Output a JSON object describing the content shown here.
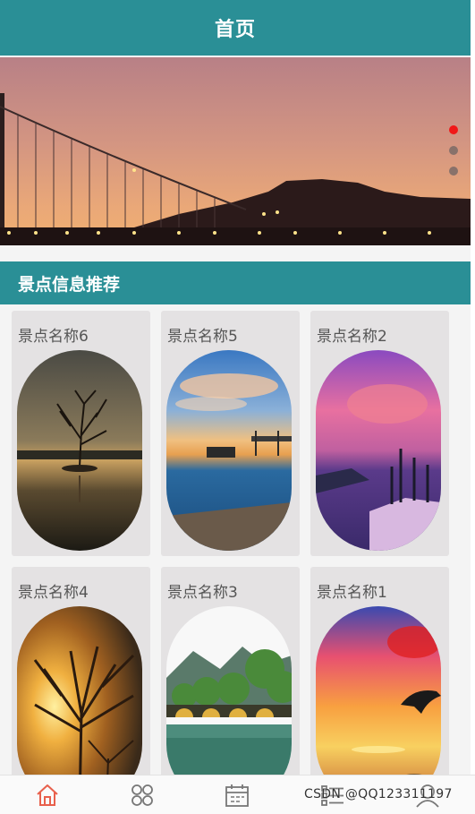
{
  "header": {
    "title": "首页"
  },
  "banner": {
    "slide_count": 3,
    "active_index": 0
  },
  "section": {
    "title": "景点信息推荐"
  },
  "spots": [
    {
      "name": "景点名称6",
      "scene": "tree-lake"
    },
    {
      "name": "景点名称5",
      "scene": "sunset-pier"
    },
    {
      "name": "景点名称2",
      "scene": "purple-lake"
    },
    {
      "name": "景点名称4",
      "scene": "sun-tree"
    },
    {
      "name": "景点名称3",
      "scene": "bridge-mountain"
    },
    {
      "name": "景点名称1",
      "scene": "dolphin-sunset"
    }
  ],
  "tabbar": {
    "items": [
      {
        "icon": "home-icon",
        "active": true
      },
      {
        "icon": "grid-icon",
        "active": false
      },
      {
        "icon": "calendar-icon",
        "active": false
      },
      {
        "icon": "list-icon",
        "active": false
      },
      {
        "icon": "user-icon",
        "active": false
      }
    ],
    "active_color": "#e8604c",
    "inactive_color": "#777777"
  },
  "watermark": "CSDN @QQ123311197",
  "colors": {
    "primary": "#2a8f96",
    "card_bg": "#e4e2e3",
    "dot_active": "#f01818"
  }
}
